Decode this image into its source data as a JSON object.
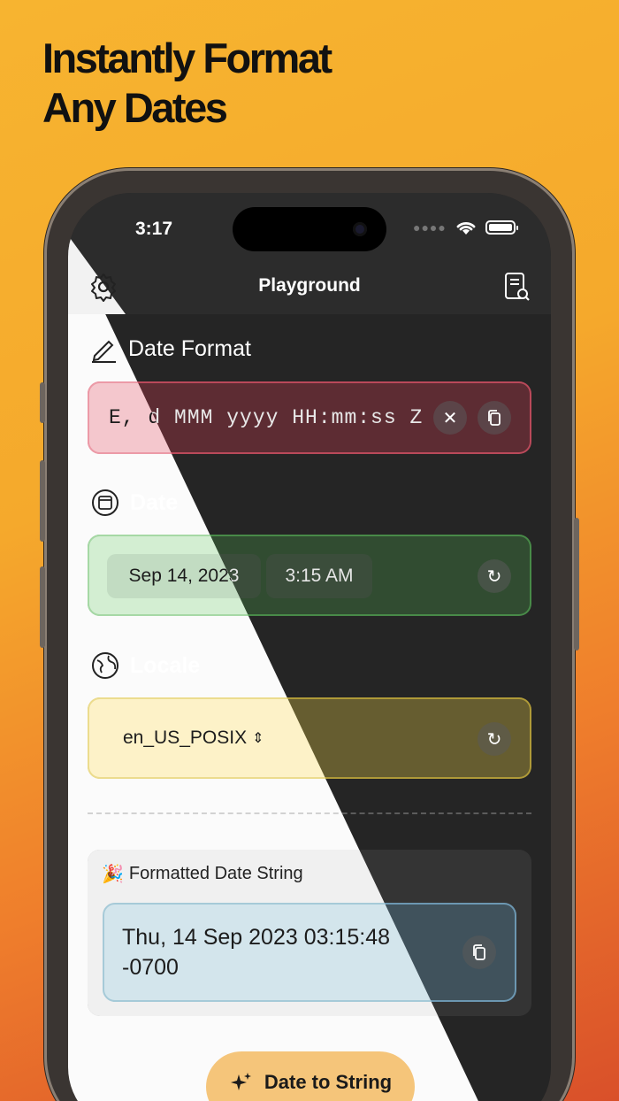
{
  "headline": {
    "line1": "Instantly Format",
    "line2": "Any Dates"
  },
  "status_bar": {
    "time": "3:17"
  },
  "nav": {
    "title": "Playground",
    "left_icon": "gear-icon",
    "right_icon": "document-search-icon"
  },
  "sections": {
    "date_format": {
      "label": "Date Format",
      "value": "E, d MMM yyyy HH:mm:ss Z"
    },
    "date": {
      "label": "Date",
      "date_value": "Sep 14, 2023",
      "time_value": "3:15 AM"
    },
    "locale": {
      "label": "Locale",
      "value": "en_US_POSIX"
    }
  },
  "result": {
    "label": "Formatted Date String",
    "value": "Thu, 14 Sep 2023 03:15:48 -0700"
  },
  "action": {
    "label": "Date to String"
  },
  "colors": {
    "background": "#f5a92c",
    "accent_button": "#f5c57a",
    "format_field": "#f4c7cd",
    "date_field": "#d3eed2",
    "locale_field": "#fdf2c8",
    "result_field": "#d3e5ec"
  }
}
